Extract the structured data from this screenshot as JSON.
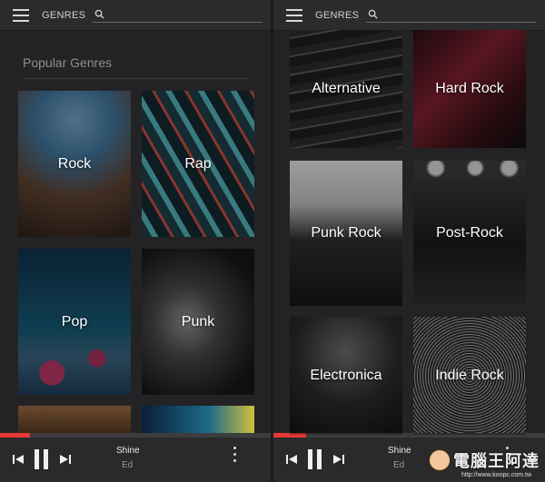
{
  "left": {
    "topbar": {
      "title": "GENRES",
      "search_placeholder": ""
    },
    "section_heading": "Popular Genres",
    "tiles": [
      {
        "label": "Rock"
      },
      {
        "label": "Rap"
      },
      {
        "label": "Pop"
      },
      {
        "label": "Punk"
      }
    ],
    "player": {
      "title": "Shine",
      "artist": "Ed",
      "progress": 0.11
    }
  },
  "right": {
    "topbar": {
      "title": "GENRES",
      "search_placeholder": ""
    },
    "tiles": [
      {
        "label": "Alternative"
      },
      {
        "label": "Hard Rock"
      },
      {
        "label": "Punk Rock"
      },
      {
        "label": "Post-Rock"
      },
      {
        "label": "Electronica"
      },
      {
        "label": "Indie Rock"
      }
    ],
    "player": {
      "title": "Shine",
      "artist": "Ed",
      "progress": 0.12
    }
  },
  "watermark": {
    "brand": "電腦王阿達",
    "url": "http://www.koopc.com.tw"
  },
  "colors": {
    "accent": "#e53935",
    "background": "#232325",
    "topbar": "#2b2b2d"
  },
  "icons": [
    "menu-icon",
    "search-icon",
    "skip-previous-icon",
    "pause-icon",
    "skip-next-icon",
    "more-vert-icon"
  ]
}
